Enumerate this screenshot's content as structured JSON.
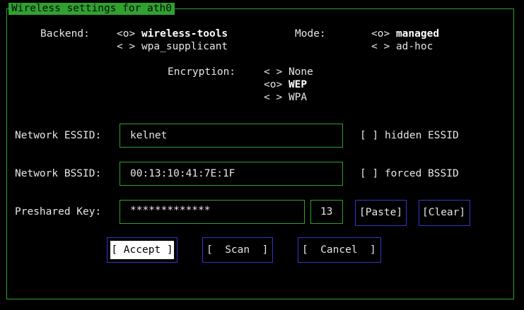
{
  "window": {
    "title": "Wireless settings for ath0"
  },
  "backend": {
    "label": "Backend:",
    "options": [
      {
        "mark": "<o>",
        "label": "wireless-tools",
        "selected": true
      },
      {
        "mark": "< >",
        "label": "wpa_supplicant",
        "selected": false
      }
    ]
  },
  "mode": {
    "label": "Mode:",
    "options": [
      {
        "mark": "<o>",
        "label": "managed",
        "selected": true
      },
      {
        "mark": "< >",
        "label": "ad-hoc",
        "selected": false
      }
    ]
  },
  "encryption": {
    "label": "Encryption:",
    "options": [
      {
        "mark": "< >",
        "label": "None",
        "selected": false
      },
      {
        "mark": "<o>",
        "label": "WEP",
        "selected": true
      },
      {
        "mark": "< >",
        "label": "WPA",
        "selected": false
      }
    ]
  },
  "essid": {
    "label": "Network ESSID:",
    "value": "kelnet",
    "checkbox_mark": "[ ]",
    "checkbox_label": "hidden ESSID"
  },
  "bssid": {
    "label": "Network BSSID:",
    "value": "00:13:10:41:7E:1F",
    "checkbox_mark": "[ ]",
    "checkbox_label": "forced BSSID"
  },
  "key": {
    "label": "Preshared Key:",
    "value": "*************",
    "length": "13",
    "paste_label": "[Paste]",
    "clear_label": "[Clear]"
  },
  "buttons": {
    "accept": "[ Accept ]",
    "scan": "[  Scan  ]",
    "cancel": "[  Cancel  ]"
  },
  "colors": {
    "frame": "#2fa12f",
    "button_border": "#3535c8",
    "background": "#000000"
  }
}
